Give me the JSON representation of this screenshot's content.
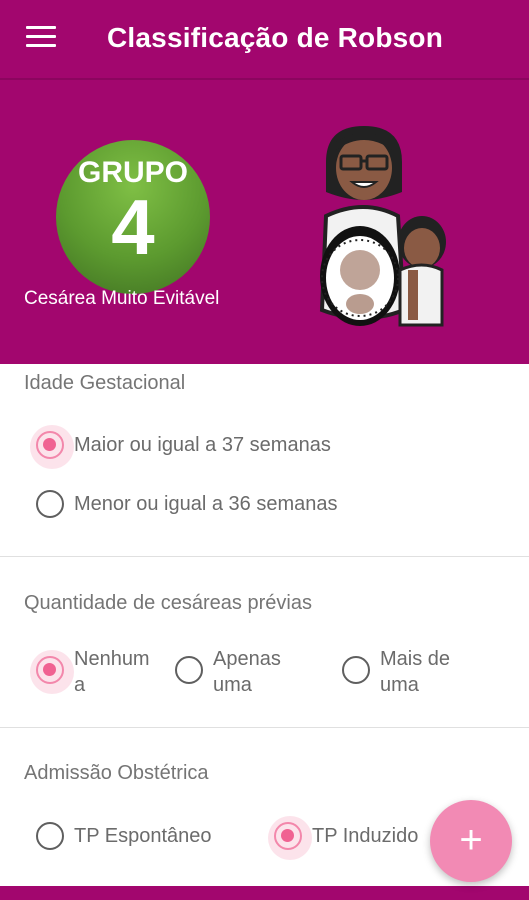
{
  "appbar": {
    "title": "Classificação de Robson",
    "menu_icon": "menu-icon"
  },
  "result": {
    "group_label": "GRUPO",
    "group_number": "4",
    "description": "Cesárea Muito Evitável",
    "badge_color": "#5c9a2f"
  },
  "sections": {
    "gestational_age": {
      "title": "Idade Gestacional",
      "options": [
        {
          "label": "Maior ou igual a 37 semanas",
          "checked": true
        },
        {
          "label": "Menor ou igual a 36 semanas",
          "checked": false
        }
      ]
    },
    "previous_cesareans": {
      "title": "Quantidade de cesáreas prévias",
      "options": [
        {
          "label": "Nenhum a",
          "checked": true
        },
        {
          "label": "Apenas uma",
          "checked": false
        },
        {
          "label": "Mais de uma",
          "checked": false
        }
      ]
    },
    "admission": {
      "title": "Admissão Obstétrica",
      "options": [
        {
          "label": "TP Espontâneo",
          "checked": false
        },
        {
          "label": "TP Induzido",
          "checked": true
        }
      ]
    }
  },
  "fab": {
    "label": "+",
    "icon": "plus-icon"
  },
  "colors": {
    "primary": "#a2066e",
    "accent": "#f06292",
    "fab": "#f28ab4"
  }
}
